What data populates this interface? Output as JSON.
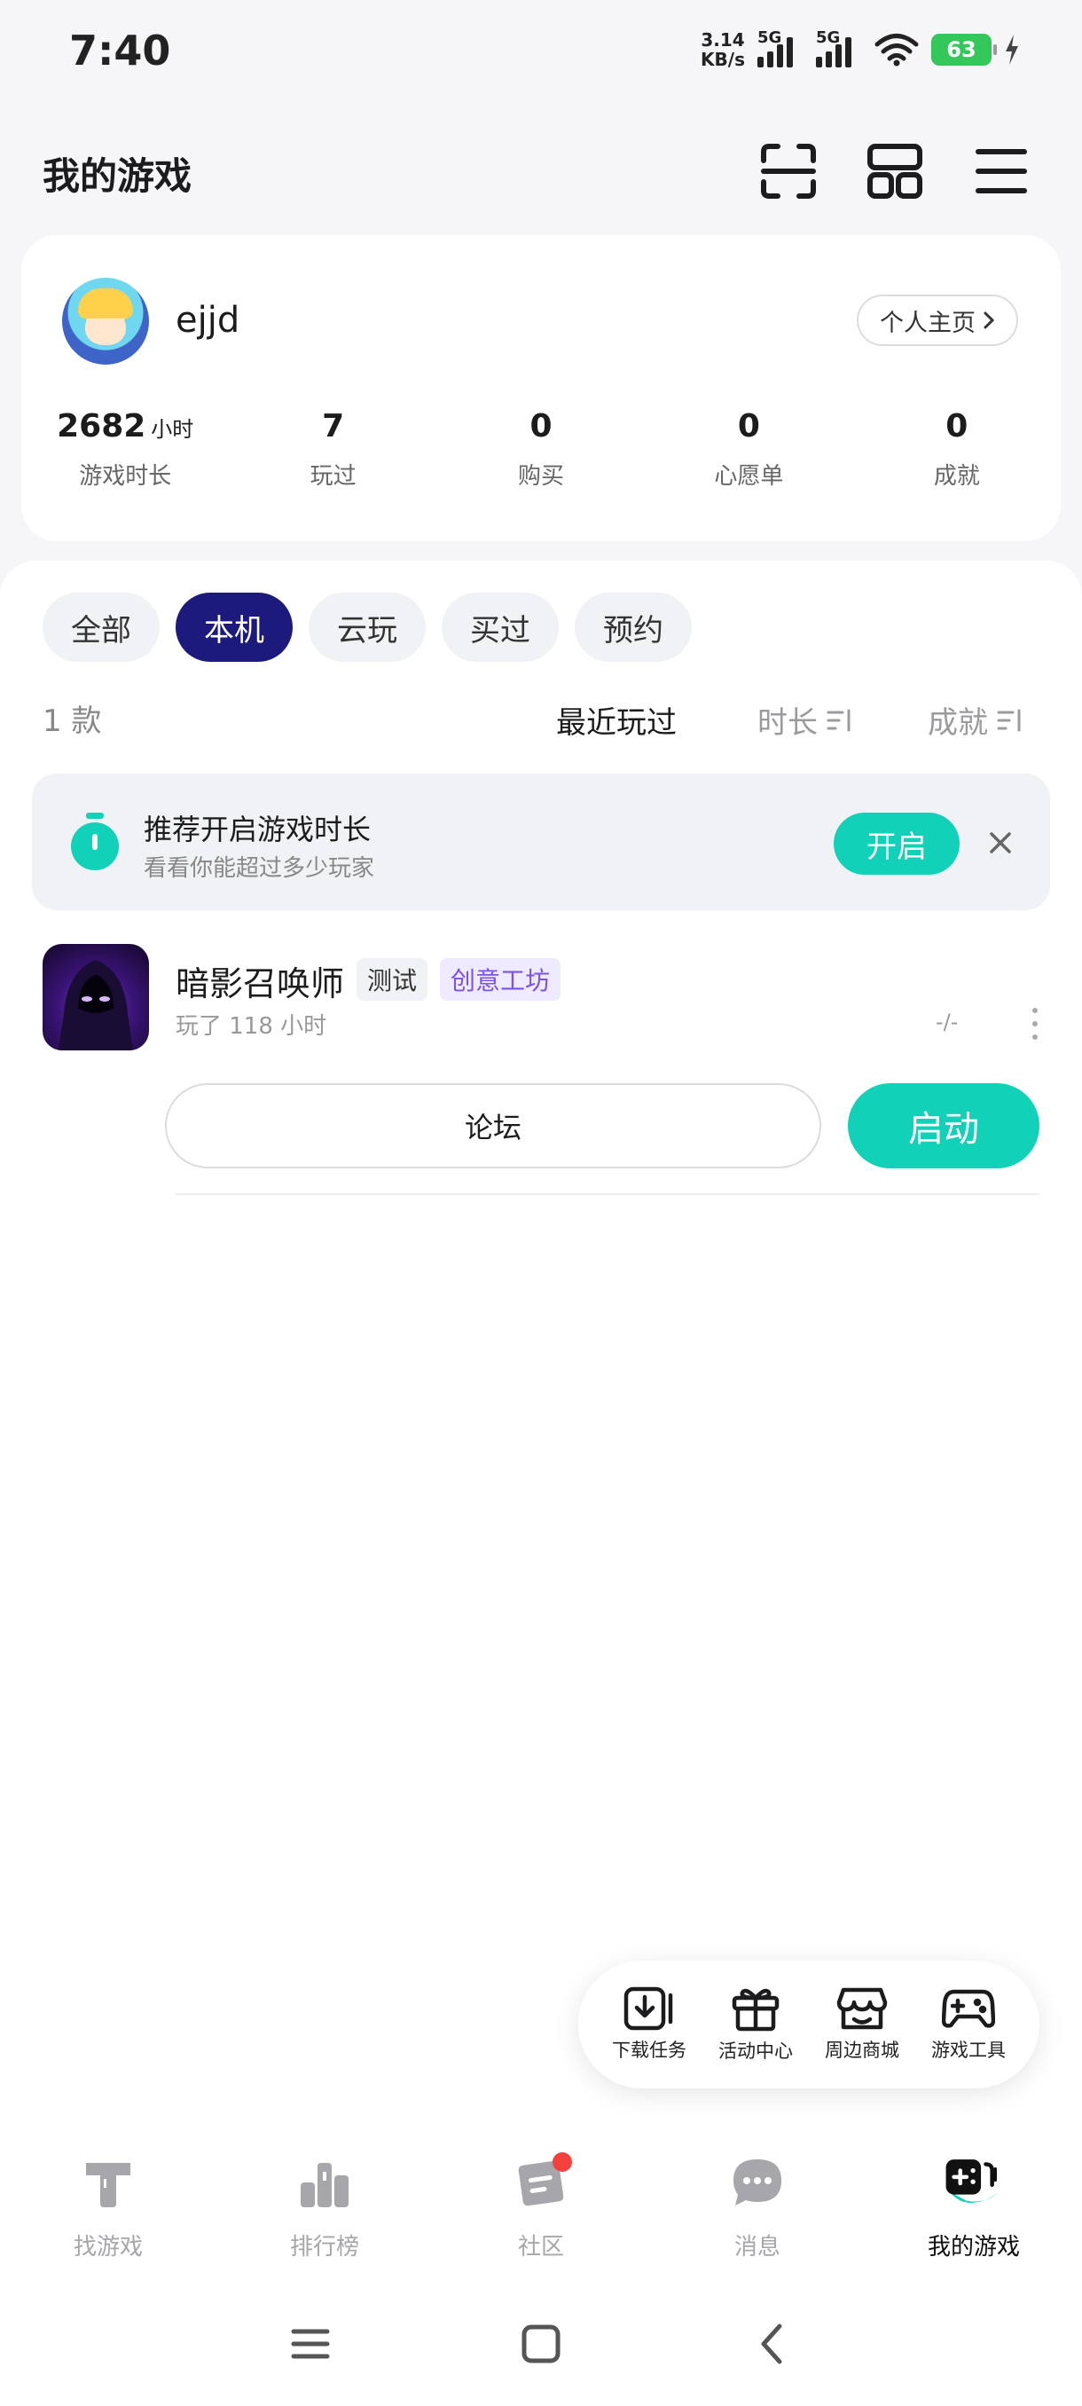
{
  "status_bar": {
    "time": "7:40",
    "net_speed_value": "3.14",
    "net_speed_unit": "KB/s",
    "signal1_label": "5G",
    "signal2_label": "5G",
    "battery": "63"
  },
  "header": {
    "title": "我的游戏"
  },
  "profile": {
    "username": "ejjd",
    "home_label": "个人主页",
    "stats": [
      {
        "value": "2682",
        "unit": "小时",
        "label": "游戏时长"
      },
      {
        "value": "7",
        "label": "玩过"
      },
      {
        "value": "0",
        "label": "购买"
      },
      {
        "value": "0",
        "label": "心愿单"
      },
      {
        "value": "0",
        "label": "成就"
      }
    ]
  },
  "tabs": [
    "全部",
    "本机",
    "云玩",
    "买过",
    "预约"
  ],
  "active_tab": "本机",
  "list": {
    "count": "1 款",
    "sort": {
      "recent": "最近玩过",
      "duration": "时长",
      "achievement": "成就"
    }
  },
  "banner": {
    "title": "推荐开启游戏时长",
    "subtitle": "看看你能超过多少玩家",
    "button": "开启"
  },
  "game": {
    "name": "暗影召唤师",
    "tag_test": "测试",
    "tag_workshop": "创意工坊",
    "played": "玩了 118 小时",
    "rating": "-/-",
    "forum_label": "论坛",
    "launch_label": "启动"
  },
  "tools": [
    {
      "icon": "download-icon",
      "label": "下载任务"
    },
    {
      "icon": "gift-icon",
      "label": "活动中心"
    },
    {
      "icon": "shop-icon",
      "label": "周边商城"
    },
    {
      "icon": "gamepad-icon",
      "label": "游戏工具"
    }
  ],
  "bottom_nav": [
    {
      "icon": "find-game-icon",
      "label": "找游戏"
    },
    {
      "icon": "ranking-icon",
      "label": "排行榜"
    },
    {
      "icon": "community-icon",
      "label": "社区"
    },
    {
      "icon": "message-icon",
      "label": "消息"
    },
    {
      "icon": "my-games-icon",
      "label": "我的游戏"
    }
  ],
  "colors": {
    "accent": "#11d2b8",
    "tab_active": "#1d1a7d",
    "badge": "#f5413d",
    "tag_workshop": "#7a53e8"
  }
}
